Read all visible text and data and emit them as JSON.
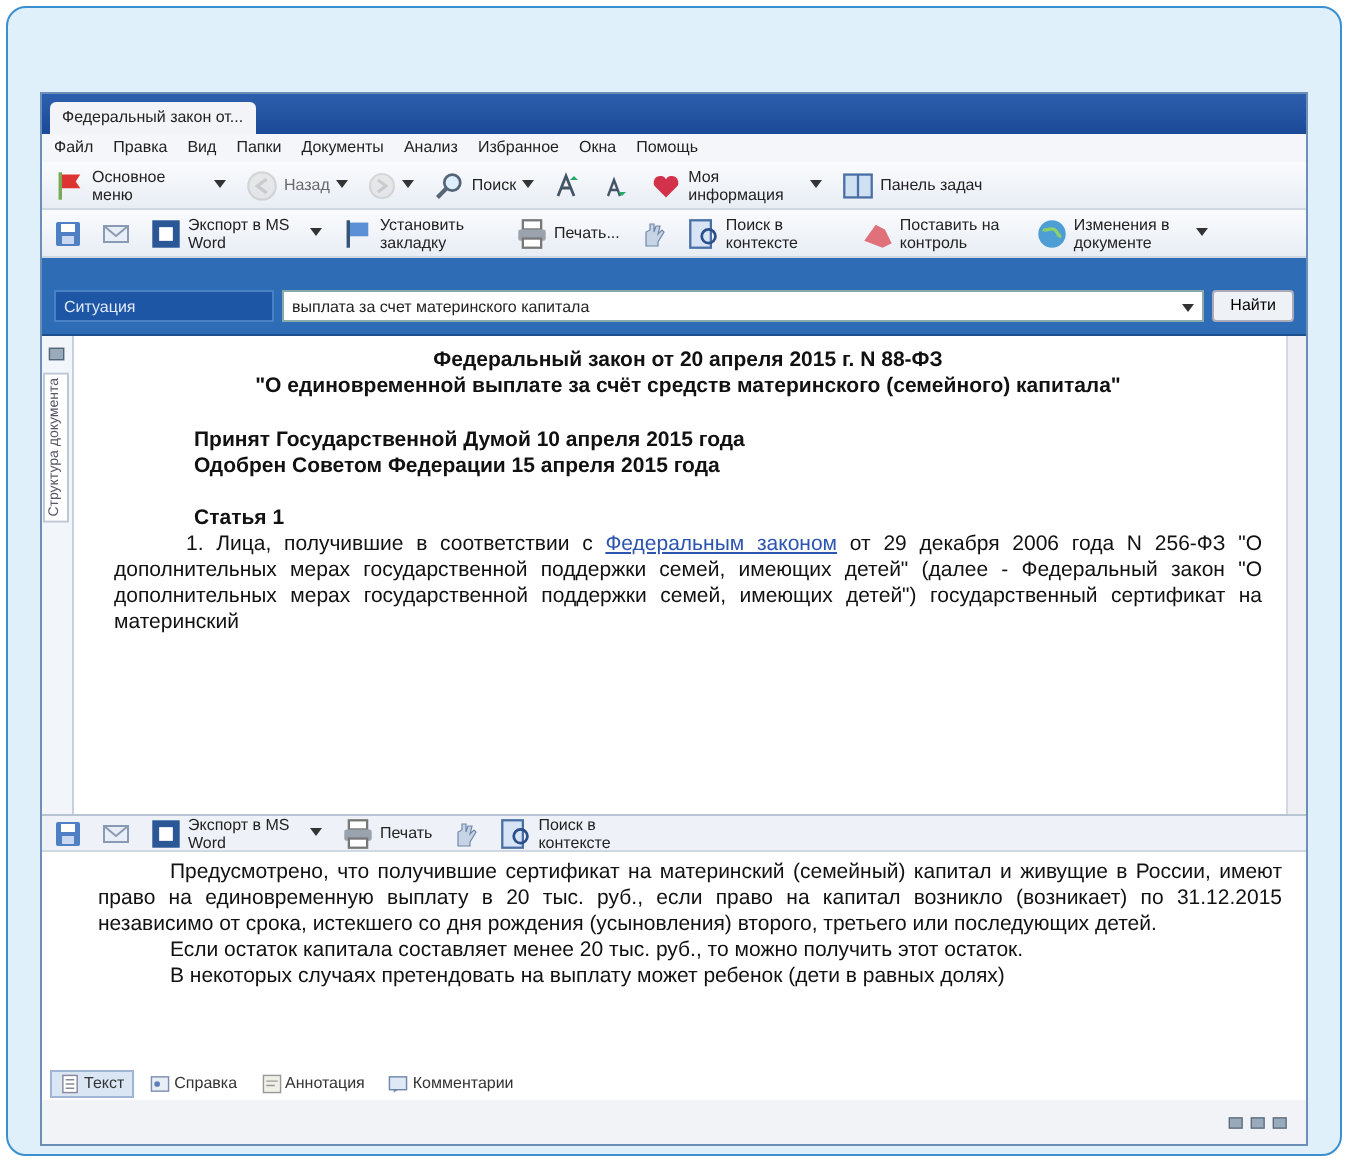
{
  "window": {
    "tab_title": "Федеральный закон от..."
  },
  "menu": [
    "Файл",
    "Правка",
    "Вид",
    "Папки",
    "Документы",
    "Анализ",
    "Избранное",
    "Окна",
    "Помощь"
  ],
  "toolbar_main": [
    {
      "label": "Основное меню",
      "dropdown": true,
      "disabled": false
    },
    {
      "label": "Назад",
      "dropdown": true,
      "disabled": true
    },
    {
      "dropdown": true,
      "disabled": true
    },
    {
      "label": "Поиск",
      "dropdown": true,
      "disabled": false
    },
    {
      "dropdown": false,
      "disabled": false
    },
    {
      "dropdown": false,
      "disabled": false
    },
    {
      "label": "Моя информация",
      "dropdown": true,
      "disabled": false
    },
    {
      "label": "Панель задач",
      "dropdown": false,
      "disabled": false
    }
  ],
  "toolbar_document": [
    {
      "dropdown": false
    },
    {
      "dropdown": false
    },
    {
      "label": "Экспорт в MS Word",
      "dropdown": true
    },
    {
      "label": "Установить закладку",
      "dropdown": false
    },
    {
      "label": "Печать...",
      "dropdown": false
    },
    {
      "dropdown": false
    },
    {
      "label": "Поиск в контексте",
      "dropdown": false
    },
    {
      "label": "Поставить на контроль",
      "dropdown": false
    },
    {
      "label": "Изменения в документе",
      "dropdown": true
    }
  ],
  "search": {
    "mode": "Ситуация",
    "query": "выплата за счет материнского капитала",
    "button": "Найти"
  },
  "side_panel": {
    "tab": "Структура документа"
  },
  "document": {
    "title": [
      "Федеральный закон от 20 апреля 2015 г. N 88-ФЗ",
      "\"О единовременной выплате за счёт средств материнского (семейного) капитала\""
    ],
    "adopted": [
      "Принят Государственной Думой 10 апреля 2015 года",
      "Одобрен Советом Федерации 15 апреля 2015 года"
    ],
    "article": "Статья 1",
    "paragraph": {
      "before": "1. Лица, получившие в соответствии с ",
      "link": "Федеральным законом",
      "after": " от 29 декабря 2006 года N 256-ФЗ \"О дополнительных мерах государственной поддержки семей, имеющих детей\" (далее - Федеральный закон \"О дополнительных мерах государственной поддержки семей, имеющих детей\") государственный сертификат на материнский"
    }
  },
  "lower_toolbar": [
    {
      "dropdown": false
    },
    {
      "dropdown": false
    },
    {
      "label": "Экспорт в MS Word",
      "dropdown": true
    },
    {
      "label": "Печать",
      "dropdown": false
    },
    {
      "dropdown": false
    },
    {
      "label": "Поиск в контексте",
      "dropdown": false
    }
  ],
  "annotation": [
    "Предусмотрено, что получившие сертификат на материнский (семейный) капитал и живущие в России, имеют право на единовременную выплату в 20 тыс. руб., если право на капитал возникло (возникает) по 31.12.2015 независимо от срока, истекшего со дня рождения (усыновления) второго, третьего или последующих детей.",
    "Если остаток капитала составляет менее 20 тыс. руб., то можно получить этот остаток.",
    "В некоторых случаях претендовать на выплату может ребенок (дети в равных долях)"
  ],
  "bottom_tabs": [
    {
      "label": "Текст",
      "selected": true
    },
    {
      "label": "Справка",
      "selected": false
    },
    {
      "label": "Аннотация",
      "selected": false
    },
    {
      "label": "Комментарии",
      "selected": false
    }
  ]
}
